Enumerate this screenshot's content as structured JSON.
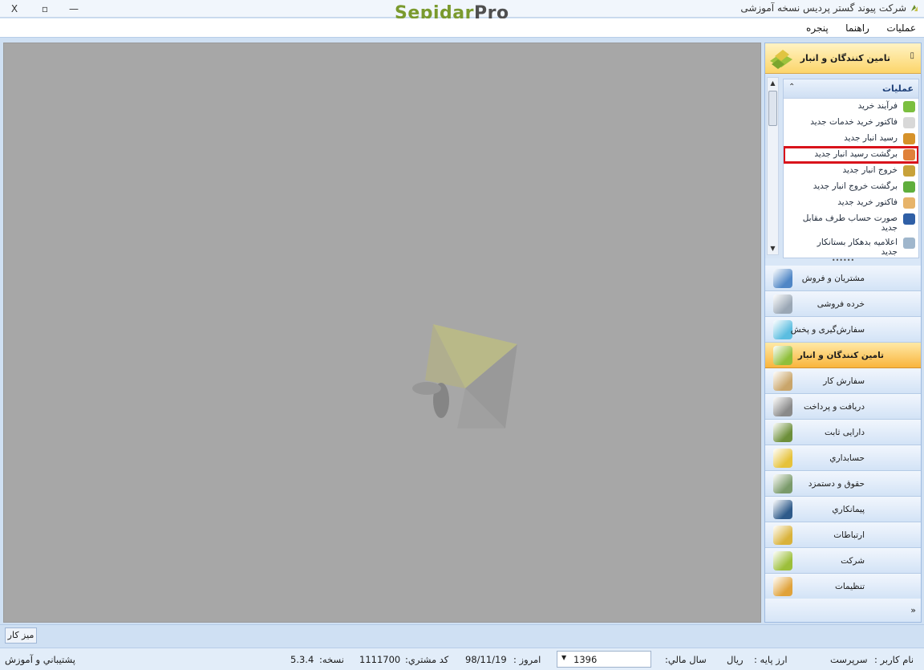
{
  "window": {
    "title": "شرکت پیوند گستر پردیس نسخه آموزشی",
    "logo_part1": "Sepidar",
    "logo_part2": "Pro",
    "buttons": {
      "close": "X",
      "restore": "▫",
      "minimize": "—"
    }
  },
  "menu": [
    {
      "label": "عملیات"
    },
    {
      "label": "راهنما"
    },
    {
      "label": "پنجره"
    }
  ],
  "right_pane": {
    "header_title": "تامین کنندگان و انبار",
    "tasks": {
      "title": "عملیات",
      "items": [
        {
          "label": "فرآیند خرید",
          "icon": "process-icon",
          "color": "#7bbf3f"
        },
        {
          "label": "فاکتور خرید خدمات جدید",
          "icon": "service-invoice-icon",
          "color": "#d8d8d8"
        },
        {
          "label": "رسید انبار جدید",
          "icon": "warehouse-receipt-icon",
          "color": "#d6922a"
        },
        {
          "label": "برگشت رسید انبار جدید",
          "icon": "receipt-return-icon",
          "color": "#e0813a",
          "highlighted": true
        },
        {
          "label": "خروج انبار جدید",
          "icon": "warehouse-exit-icon",
          "color": "#c8a23a"
        },
        {
          "label": "برگشت خروج انبار جدید",
          "icon": "exit-return-icon",
          "color": "#5fae3c"
        },
        {
          "label": "فاکتور خرید جدید",
          "icon": "purchase-invoice-icon",
          "color": "#e7b46a"
        },
        {
          "label": "صورت حساب طرف مقابل جدید",
          "icon": "statement-icon",
          "color": "#2f5fa6",
          "tall": true
        },
        {
          "label": "اعلامیه بدهکار بستانکار جدید",
          "icon": "debit-credit-icon",
          "color": "#9fb6cc",
          "tall": true
        }
      ]
    },
    "nav": [
      {
        "label": "مشتریان و فروش",
        "icon": "customers-sales-icon",
        "color": "#4f86c6"
      },
      {
        "label": "خرده فروشی",
        "icon": "retail-cart-icon",
        "color": "#9aa7b5"
      },
      {
        "label": "سفارش‌گیری و پخش",
        "icon": "order-distribution-icon",
        "color": "#5bbde0"
      },
      {
        "label": "تامین کنندگان و انبار",
        "icon": "suppliers-warehouse-icon",
        "color": "#8fbf3a",
        "active": true
      },
      {
        "label": "سفارش کار",
        "icon": "work-order-icon",
        "color": "#c9a56a"
      },
      {
        "label": "دریافت و پرداخت",
        "icon": "receive-pay-icon",
        "color": "#8a8a8a"
      },
      {
        "label": "دارایی ثابت",
        "icon": "fixed-assets-icon",
        "color": "#6d8f3a"
      },
      {
        "label": "حسابداري",
        "icon": "accounting-icon",
        "color": "#e6c23a"
      },
      {
        "label": "حقوق و دستمزد",
        "icon": "payroll-icon",
        "color": "#7a9a6a"
      },
      {
        "label": "پیمانکاري",
        "icon": "contracting-icon",
        "color": "#2e5a8a"
      },
      {
        "label": "ارتباطات",
        "icon": "communications-icon",
        "color": "#d9b23a"
      },
      {
        "label": "شرکت",
        "icon": "company-icon",
        "color": "#9cbf3a"
      },
      {
        "label": "تنظیمات",
        "icon": "settings-gear-icon",
        "color": "#e0a23a"
      }
    ]
  },
  "desktop_tab": "میز کار",
  "status": {
    "support": "پشتيباني و آموزش",
    "version_label": "نسخه:",
    "version": "5.3.4",
    "customer_code_label": "کد مشتري:",
    "customer_code": "1111700",
    "today_label": "امروز :",
    "today": "98/11/19",
    "fiscal_year": "1396",
    "fiscal_year_label": "سال مالي:",
    "currency_label": "ارز پايه :",
    "currency": "ريال",
    "user_label": "نام کاربر :",
    "user": "سرپرست"
  }
}
